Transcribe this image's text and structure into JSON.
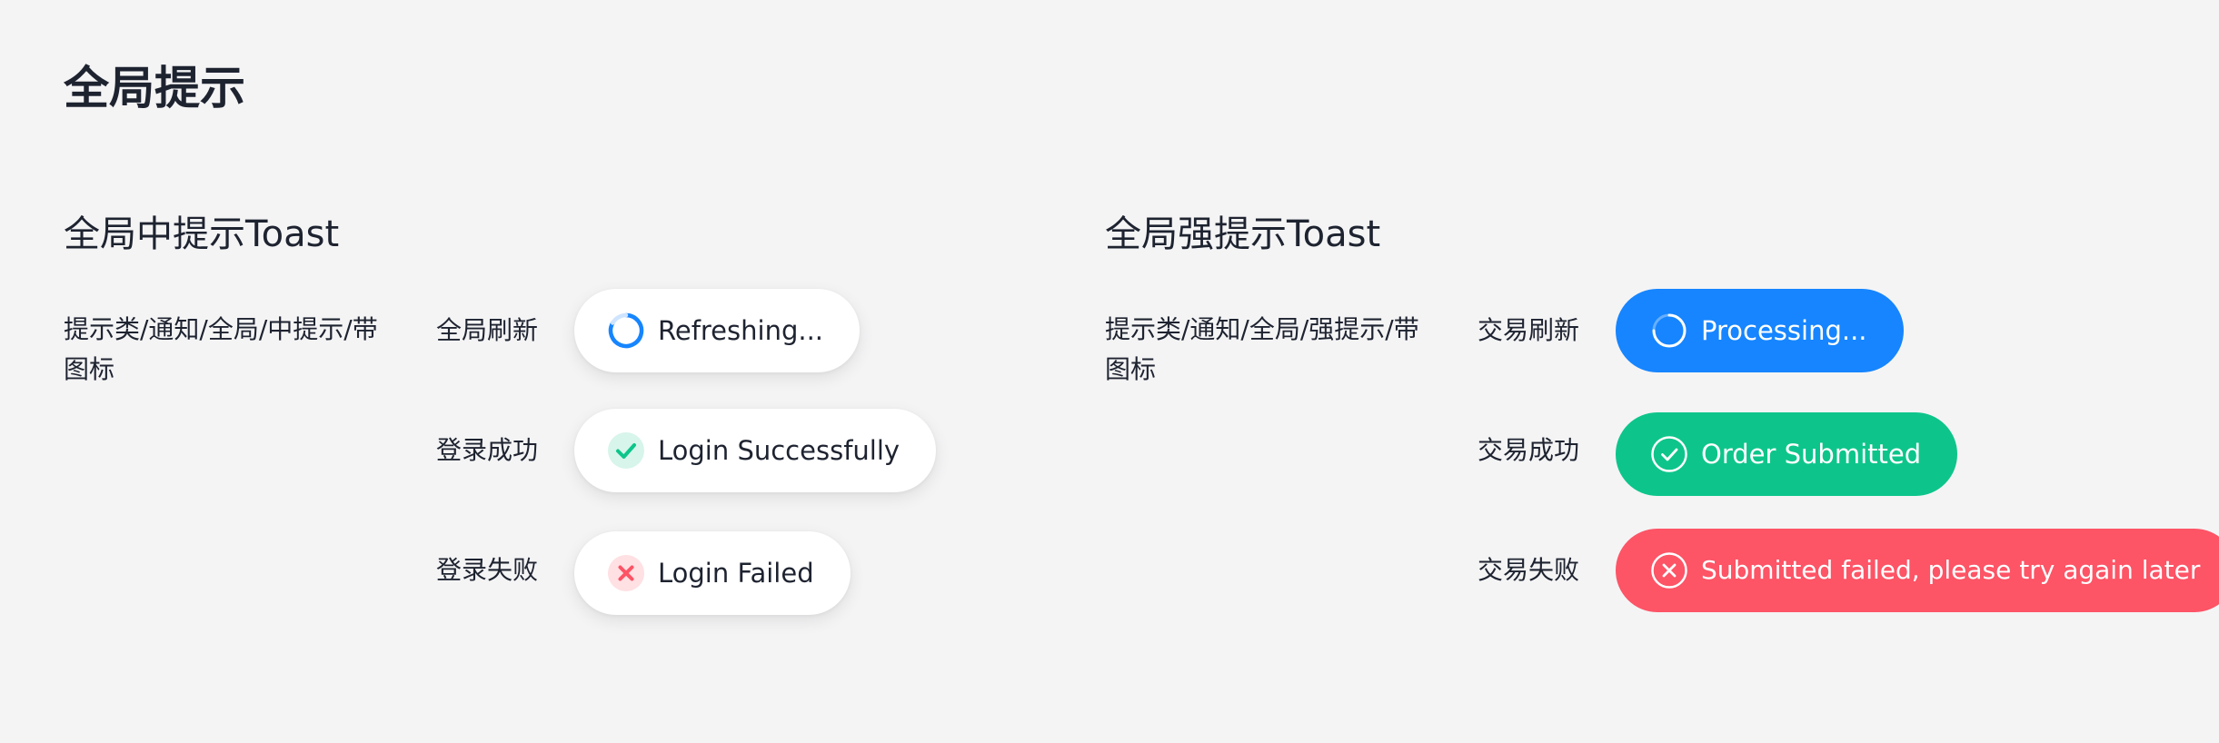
{
  "page": {
    "title": "全局提示"
  },
  "colors": {
    "background": "#f4f4f5",
    "text": "#1e2330",
    "refresh_blue": "#1685ff",
    "success_green": "#0dc58a",
    "fail_red": "#fd5466",
    "success_icon_bg": "#d7f5ea",
    "fail_icon_bg": "#ffe0e3"
  },
  "sections": {
    "center_toast": {
      "title": "全局中提示Toast",
      "description": "提示类/通知/全局/中提示/带图标",
      "rows": [
        {
          "label": "全局刷新",
          "text": "Refreshing...",
          "icon": "spinner-icon"
        },
        {
          "label": "登录成功",
          "text": "Login Successfully",
          "icon": "check-circle-icon"
        },
        {
          "label": "登录失败",
          "text": "Login Failed",
          "icon": "close-circle-icon"
        }
      ]
    },
    "strong_toast": {
      "title": "全局强提示Toast",
      "description": "提示类/通知/全局/强提示/带图标",
      "rows": [
        {
          "label": "交易刷新",
          "text": "Processing...",
          "icon": "spinner-icon"
        },
        {
          "label": "交易成功",
          "text": "Order Submitted",
          "icon": "check-circle-icon"
        },
        {
          "label": "交易失败",
          "text": "Submitted failed, please try again later",
          "icon": "close-circle-icon"
        }
      ]
    }
  }
}
